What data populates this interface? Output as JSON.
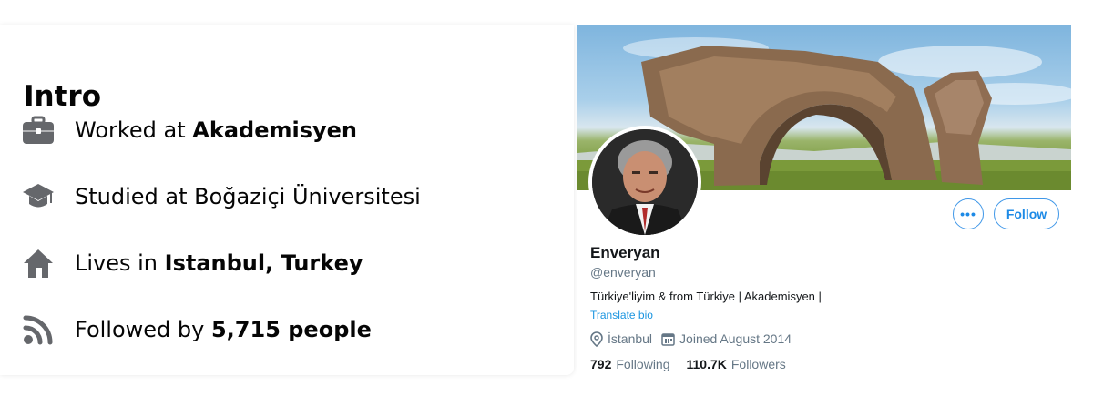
{
  "intro": {
    "title": "Intro",
    "rows": [
      {
        "icon": "briefcase-icon",
        "prefix": "Worked at ",
        "bold": "Akademisyen"
      },
      {
        "icon": "graduation-cap-icon",
        "prefix": "Studied at Boğaziçi Üniversitesi",
        "bold": ""
      },
      {
        "icon": "home-icon",
        "prefix": "Lives in ",
        "bold": "Istanbul, Turkey"
      },
      {
        "icon": "rss-feed-icon",
        "prefix": "Followed by ",
        "bold": "5,715 people"
      }
    ]
  },
  "twitter": {
    "name": "Enveryan",
    "handle": "@enveryan",
    "bio": "Türkiye'liyim & from Türkiye | Akademisyen |",
    "translate_label": "Translate bio",
    "location": "İstanbul",
    "joined": "Joined August 2014",
    "following_count": "792",
    "following_label": "Following",
    "followers_count": "110.7K",
    "followers_label": "Followers",
    "more_button_label": "•••",
    "follow_button_label": "Follow"
  },
  "colors": {
    "accent": "#1da1f2",
    "icon_gray": "#65676b",
    "text_secondary": "#657786"
  }
}
